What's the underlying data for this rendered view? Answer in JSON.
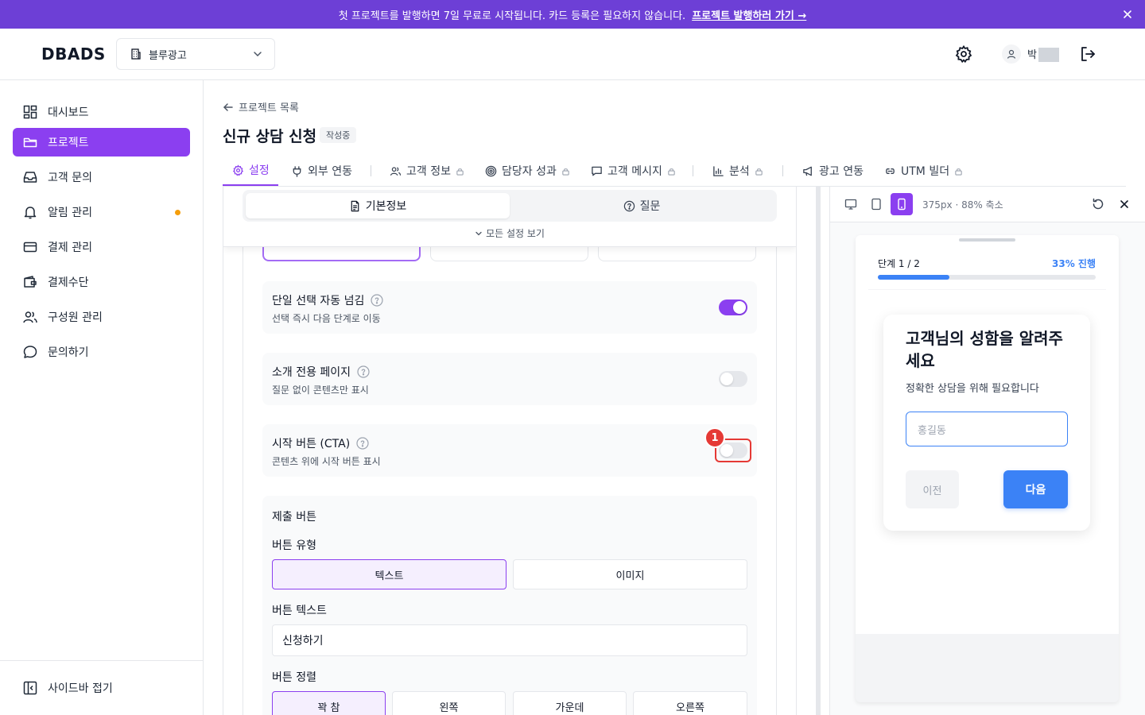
{
  "banner": {
    "message": "첫 프로젝트를 발행하면 7일 무료로 시작됩니다. 카드 등록은 필요하지 않습니다.",
    "link": "프로젝트 발행하러 가기 →"
  },
  "header": {
    "logo": "DBADS",
    "org": "블루광고",
    "user_initial": "박"
  },
  "sidebar": {
    "items": [
      {
        "label": "대시보드",
        "icon": "dashboard-icon"
      },
      {
        "label": "프로젝트",
        "icon": "folder-icon",
        "active": true
      },
      {
        "label": "고객 문의",
        "icon": "inbox-icon"
      },
      {
        "label": "알림 관리",
        "icon": "bell-icon",
        "dot": true
      },
      {
        "label": "결제 관리",
        "icon": "credit-card-icon"
      },
      {
        "label": "결제수단",
        "icon": "wallet-icon"
      },
      {
        "label": "구성원 관리",
        "icon": "users-icon"
      },
      {
        "label": "문의하기",
        "icon": "chat-icon"
      }
    ],
    "collapse": "사이드바 접기"
  },
  "main": {
    "back": "프로젝트 목록",
    "title": "신규 상담 신청",
    "status": "작성중",
    "tabs": [
      {
        "label": "설정",
        "active": true
      },
      {
        "label": "외부 연동"
      },
      {
        "label": "고객 정보",
        "locked": true
      },
      {
        "label": "담당자 성과",
        "locked": true
      },
      {
        "label": "고객 메시지",
        "locked": true
      },
      {
        "label": "분석",
        "locked": true
      },
      {
        "label": "광고 연동"
      },
      {
        "label": "UTM 빌더",
        "locked": true
      }
    ]
  },
  "editor": {
    "segments": [
      "기본정보",
      "질문"
    ],
    "view_all": "모든 설정 보기",
    "settings": [
      {
        "title": "단일 선택 자동 넘김",
        "desc": "선택 즉시 다음 단계로 이동",
        "on": true
      },
      {
        "title": "소개 전용 페이지",
        "desc": "질문 없이 콘텐츠만 표시",
        "on": false
      },
      {
        "title": "시작 버튼 (CTA)",
        "desc": "콘텐츠 위에 시작 버튼 표시",
        "on": false
      }
    ],
    "callout_number": "1",
    "submit": {
      "title": "제출 버튼",
      "type_label": "버튼 유형",
      "type_options": [
        "텍스트",
        "이미지"
      ],
      "text_label": "버튼 텍스트",
      "text_value": "신청하기",
      "align_label": "버튼 정렬",
      "align_options": [
        "꽉 참",
        "왼쪽",
        "가운데",
        "오른쪽"
      ]
    }
  },
  "preview": {
    "info": "375px · 88% 축소",
    "step": "단계 1 / 2",
    "progress_label": "33% 진행",
    "progress": 0.33,
    "question": "고객님의 성함을 알려주세요",
    "subtext": "정확한 상담을 위해 필요합니다",
    "input_placeholder": "홍길동",
    "prev": "이전",
    "next": "다음"
  },
  "colors": {
    "brand": "#8b3ff0",
    "banner": "#6d3fd6",
    "preview_accent": "#3b82f6",
    "callout": "#e53935"
  }
}
